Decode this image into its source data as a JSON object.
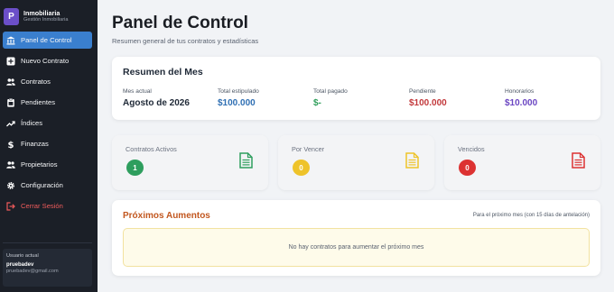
{
  "brand": {
    "logo_letter": "P",
    "name": "Inmobiliaria",
    "subtitle": "Gestión Inmobiliaria"
  },
  "sidebar": {
    "items": [
      {
        "label": "Panel de Control",
        "icon": "bank-icon",
        "active": true
      },
      {
        "label": "Nuevo Contrato",
        "icon": "plus-square-icon"
      },
      {
        "label": "Contratos",
        "icon": "people-icon"
      },
      {
        "label": "Pendientes",
        "icon": "clipboard-icon"
      },
      {
        "label": "Índices",
        "icon": "trending-up-icon"
      },
      {
        "label": "Finanzas",
        "icon": "dollar-icon"
      },
      {
        "label": "Propietarios",
        "icon": "people-icon"
      },
      {
        "label": "Configuración",
        "icon": "gear-icon"
      },
      {
        "label": "Cerrar Sesión",
        "icon": "logout-icon",
        "danger": true
      }
    ],
    "user": {
      "label": "Usuario actual",
      "name": "pruebadev",
      "email": "pruebadev@gmail.com"
    }
  },
  "header": {
    "title": "Panel de Control",
    "subtitle": "Resumen general de tus contratos y estadísticas"
  },
  "summary": {
    "title": "Resumen del Mes",
    "metrics": [
      {
        "label": "Mes actual",
        "value": "Agosto de 2026",
        "color": "#1f2937"
      },
      {
        "label": "Total estipulado",
        "value": "$100.000",
        "color": "#2f6fb3"
      },
      {
        "label": "Total pagado",
        "value": "$-",
        "color": "#2f9e5b"
      },
      {
        "label": "Pendiente",
        "value": "$100.000",
        "color": "#c2383b"
      },
      {
        "label": "Honorarios",
        "value": "$10.000",
        "color": "#6a45c2"
      }
    ]
  },
  "stats": [
    {
      "label": "Contratos Activos",
      "count": "1",
      "color": "#2e9e5e"
    },
    {
      "label": "Por Vencer",
      "count": "0",
      "color": "#eec32a"
    },
    {
      "label": "Vencidos",
      "count": "0",
      "color": "#dc3232"
    }
  ],
  "upcoming": {
    "title": "Próximos Aumentos",
    "note": "Para el próximo mes (con 15 días de antelación)",
    "empty_message": "No hay contratos para aumentar el próximo mes"
  }
}
